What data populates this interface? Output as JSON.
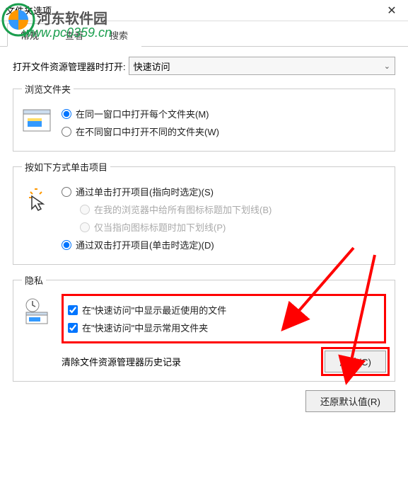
{
  "window": {
    "title": "文件夹选项"
  },
  "watermark": {
    "text": "河东软件园",
    "url": "www.pc0359.cn"
  },
  "tabs": {
    "general": "常规",
    "view": "查看",
    "search": "搜索"
  },
  "openExplorer": {
    "label": "打开文件资源管理器时打开:",
    "value": "快速访问"
  },
  "browseFolders": {
    "legend": "浏览文件夹",
    "opt1": "在同一窗口中打开每个文件夹(M)",
    "opt2": "在不同窗口中打开不同的文件夹(W)"
  },
  "clickItems": {
    "legend": "按如下方式单击项目",
    "opt1": "通过单击打开项目(指向时选定)(S)",
    "opt1a": "在我的浏览器中给所有图标标题加下划线(B)",
    "opt1b": "仅当指向图标标题时加下划线(P)",
    "opt2": "通过双击打开项目(单击时选定)(D)"
  },
  "privacy": {
    "legend": "隐私",
    "chk1": "在\"快速访问\"中显示最近使用的文件",
    "chk2": "在\"快速访问\"中显示常用文件夹",
    "clearLabel": "清除文件资源管理器历史记录",
    "clearBtn": "清除(C)"
  },
  "footer": {
    "restore": "还原默认值(R)"
  }
}
